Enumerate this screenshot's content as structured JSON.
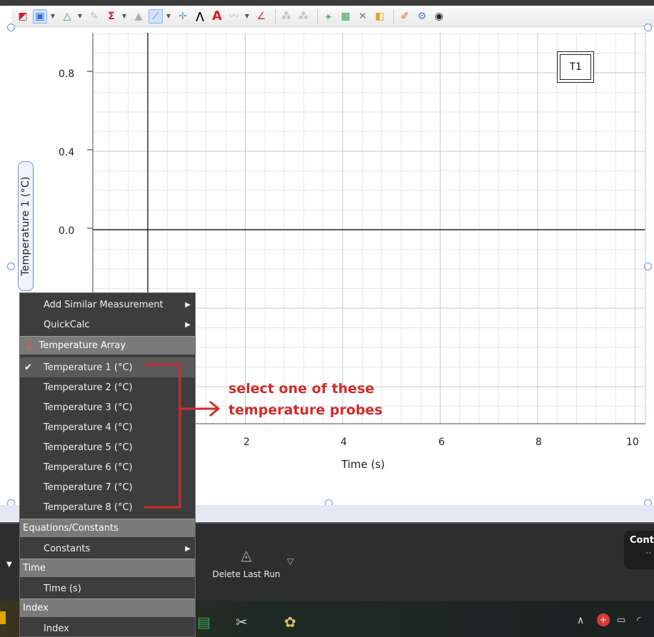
{
  "plot": {
    "y_axis_label": "Temperature 1 (°C)",
    "y_ticks": [
      "0.8",
      "0.4",
      "0.0"
    ],
    "x_ticks": [
      "2",
      "4",
      "6",
      "8",
      "10"
    ],
    "x_axis_label": "Time (s)",
    "legend": "T1"
  },
  "menu": {
    "items_top": [
      {
        "label": "Add Similar Measurement",
        "has_submenu": true
      },
      {
        "label": "QuickCalc",
        "has_submenu": true
      }
    ],
    "section_temperature": "Temperature Array",
    "temperature_items": [
      "Temperature 1 (°C)",
      "Temperature 2 (°C)",
      "Temperature 3 (°C)",
      "Temperature 4 (°C)",
      "Temperature 5 (°C)",
      "Temperature 6 (°C)",
      "Temperature 7 (°C)",
      "Temperature 8 (°C)"
    ],
    "checked_index": 0,
    "section_equations": "Equations/Constants",
    "constants_label": "Constants",
    "section_time": "Time",
    "time_item": "Time (s)",
    "section_index": "Index",
    "index_item": "Index"
  },
  "annotation": {
    "line1": "select one of these",
    "line2": "temperature probes",
    "color": "#d12b2b"
  },
  "bottom": {
    "delete_last_run": "Delete Last Run",
    "cont_label": "Cont",
    "cont_sub": ".."
  },
  "colors": {
    "grid_major": "#c8c8c8",
    "grid_minor": "#e6e6e6",
    "menu_bg": "#3d3d3d",
    "section_bg": "#7a7a7a"
  }
}
